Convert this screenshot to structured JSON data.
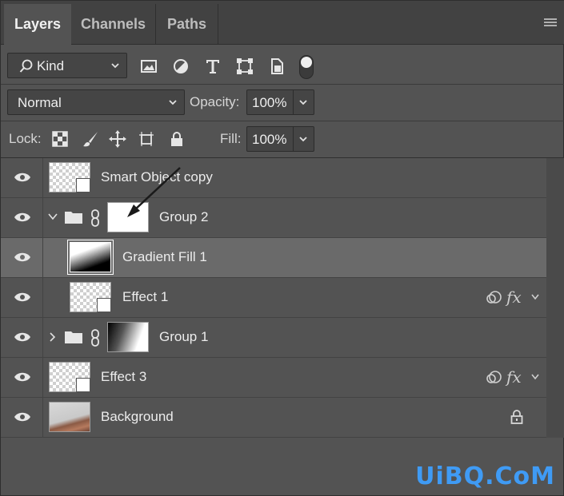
{
  "tabs": [
    {
      "label": "Layers",
      "active": true
    },
    {
      "label": "Channels",
      "active": false
    },
    {
      "label": "Paths",
      "active": false
    }
  ],
  "filter": {
    "kind_label": "Kind",
    "icons": [
      "image-filter-icon",
      "adjustment-filter-icon",
      "type-filter-icon",
      "shape-filter-icon",
      "smart-object-filter-icon"
    ]
  },
  "blend": {
    "mode": "Normal",
    "opacity_label": "Opacity:",
    "opacity_value": "100%"
  },
  "lock": {
    "label": "Lock:",
    "fill_label": "Fill:",
    "fill_value": "100%"
  },
  "layers": [
    {
      "name": "Smart Object copy",
      "type": "smart-object",
      "thumb": "checker",
      "fx": false,
      "locked": false,
      "indent": 0
    },
    {
      "name": "Group 2",
      "type": "group",
      "expanded": true,
      "mask": "white",
      "indent": 0
    },
    {
      "name": "Gradient Fill 1",
      "type": "gradient-fill",
      "selected": true,
      "indent": 1
    },
    {
      "name": "Effect 1",
      "type": "smart-object",
      "thumb": "checker",
      "fx": true,
      "indent": 1
    },
    {
      "name": "Group 1",
      "type": "group",
      "expanded": false,
      "mask": "gradient",
      "indent": 0
    },
    {
      "name": "Effect 3",
      "type": "smart-object",
      "thumb": "checker",
      "fx": true,
      "indent": 0
    },
    {
      "name": "Background",
      "type": "background",
      "locked": true,
      "indent": 0
    }
  ],
  "fx_text": "fx",
  "watermark": "UiBQ.CoM",
  "colors": {
    "panel": "#535353",
    "selected_row": "#6a6a6a",
    "tabbar": "#424242",
    "watermark": "#3f9bf5"
  }
}
